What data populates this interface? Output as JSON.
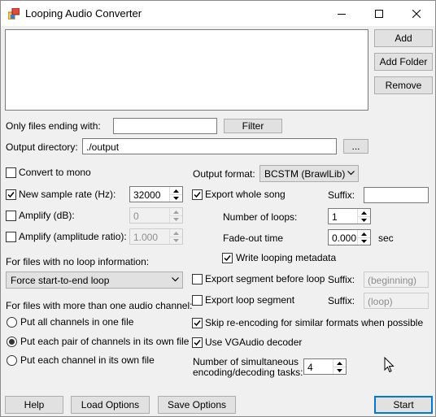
{
  "window": {
    "title": "Looping Audio Converter",
    "controls": {
      "minimize": "minimize",
      "maximize": "maximize",
      "close": "close"
    }
  },
  "files": {
    "add": "Add",
    "add_folder": "Add Folder",
    "remove": "Remove",
    "items": []
  },
  "filter": {
    "label": "Only files ending with:",
    "value": "",
    "button": "Filter"
  },
  "output_dir": {
    "label": "Output directory:",
    "value": "./output",
    "browse": "..."
  },
  "convert_mono": {
    "label": "Convert to mono",
    "checked": false
  },
  "sample_rate": {
    "label": "New sample rate (Hz):",
    "checked": true,
    "value": "32000"
  },
  "amplify_db": {
    "label": "Amplify (dB):",
    "checked": false,
    "value": "0"
  },
  "amplify_ratio": {
    "label": "Amplify (amplitude ratio):",
    "checked": false,
    "value": "1.000"
  },
  "no_loop": {
    "label": "For files with no loop information:",
    "selected": "Force start-to-end loop"
  },
  "channels": {
    "label": "For files with more than one audio channel:",
    "options": [
      {
        "label": "Put all channels in one file",
        "selected": false
      },
      {
        "label": "Put each pair of channels in its own file",
        "selected": true
      },
      {
        "label": "Put each channel in its own file",
        "selected": false
      }
    ]
  },
  "output_format": {
    "label": "Output format:",
    "selected": "BCSTM (BrawlLib)"
  },
  "export_whole": {
    "label": "Export whole song",
    "checked": true,
    "suffix_label": "Suffix:",
    "suffix": ""
  },
  "loops": {
    "label": "Number of loops:",
    "value": "1"
  },
  "fadeout": {
    "label": "Fade-out time",
    "value": "0.000",
    "unit": "sec"
  },
  "write_meta": {
    "label": "Write looping metadata",
    "checked": true
  },
  "export_before": {
    "label": "Export segment before loop",
    "checked": false,
    "suffix_label": "Suffix:",
    "suffix": "(beginning)"
  },
  "export_loop": {
    "label": "Export loop segment",
    "checked": false,
    "suffix_label": "Suffix:",
    "suffix": "(loop)"
  },
  "skip_reencode": {
    "label": "Skip re-encoding for similar formats when possible",
    "checked": true
  },
  "vgaudio": {
    "label": "Use VGAudio decoder",
    "checked": true
  },
  "tasks": {
    "label_line1": "Number of simultaneous",
    "label_line2": "encoding/decoding tasks:",
    "value": "4"
  },
  "bottom": {
    "help": "Help",
    "load": "Load Options",
    "save": "Save Options",
    "start": "Start"
  }
}
